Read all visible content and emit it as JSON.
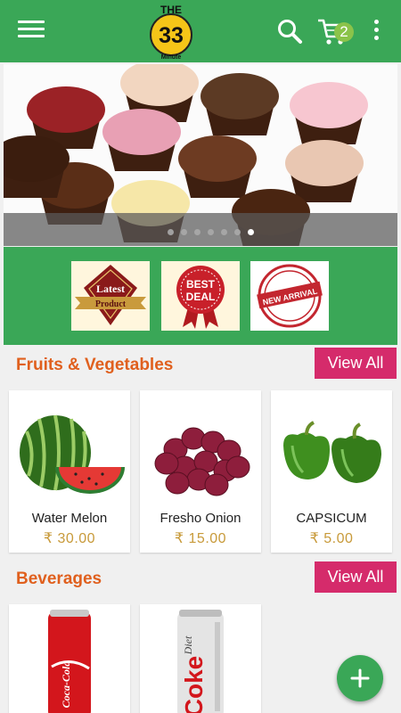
{
  "app": {
    "logo_text_top": "THE",
    "logo_number": "33",
    "logo_text_bottom": "Minute",
    "cart_count": "2",
    "colors": {
      "primary": "#3aa757",
      "accent": "#d52b6b",
      "section_title": "#e0601e",
      "price": "#c89a3a"
    }
  },
  "header_icons": [
    "menu-icon",
    "search-icon",
    "cart-icon",
    "more-vert-icon"
  ],
  "banner": {
    "slide_count": 7,
    "active_slide_index": 6
  },
  "badges": [
    {
      "line1": "Latest",
      "line2": "Product"
    },
    {
      "line1": "BEST",
      "line2": "DEAL"
    },
    {
      "line1": "NEW ARRIVAL"
    }
  ],
  "sections": [
    {
      "title": "Fruits & Vegetables",
      "view_all": "View All",
      "products": [
        {
          "name": "Water Melon",
          "price": "₹ 30.00"
        },
        {
          "name": "Fresho Onion",
          "price": "₹ 15.00"
        },
        {
          "name": "CAPSICUM",
          "price": "₹ 5.00"
        }
      ]
    },
    {
      "title": "Beverages",
      "view_all": "View All",
      "products": [
        {
          "can_label": "Coca-Cola"
        },
        {
          "can_label_small": "Diet",
          "can_label_big": "Coke"
        }
      ]
    }
  ],
  "fab": {
    "icon": "plus-icon",
    "symbol": "+"
  }
}
